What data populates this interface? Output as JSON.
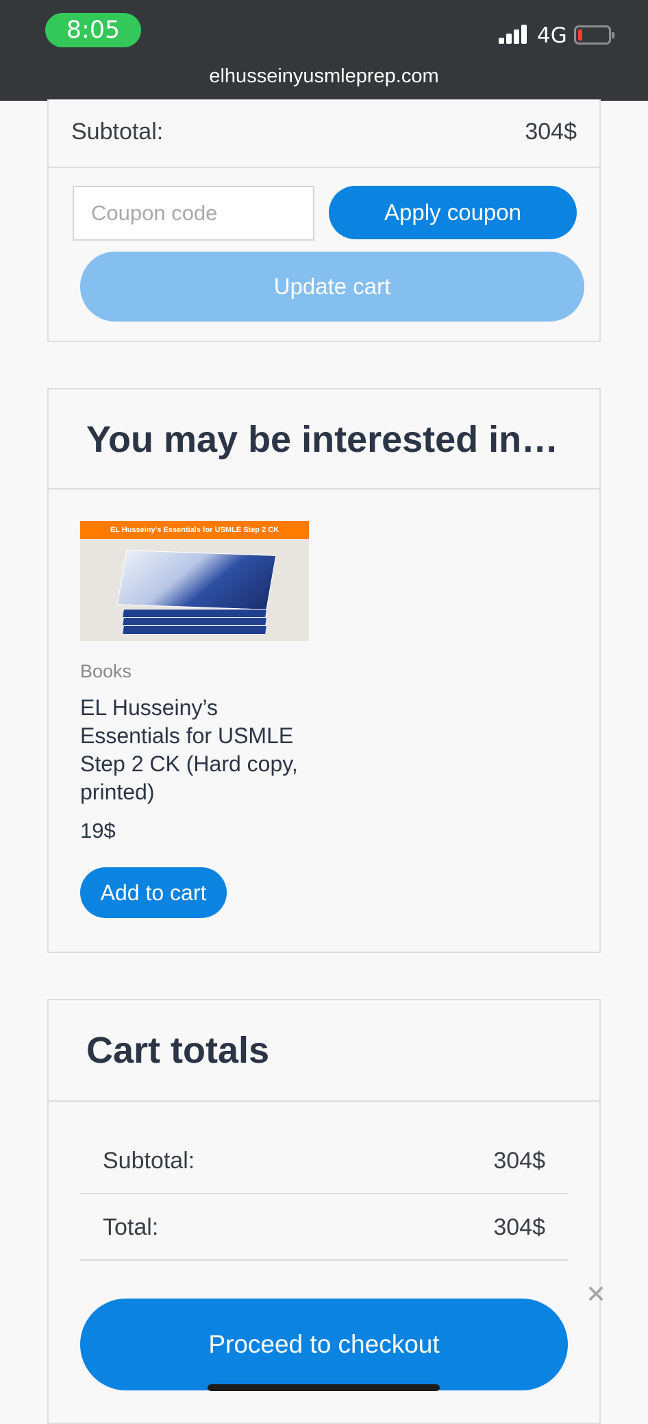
{
  "status_bar": {
    "time": "8:05",
    "network": "4G",
    "url": "elhusseinyusmleprep.com"
  },
  "cart_summary": {
    "subtotal_label": "Subtotal:",
    "subtotal_value": "304$",
    "coupon_placeholder": "Coupon code",
    "apply_coupon_label": "Apply coupon",
    "update_cart_label": "Update cart"
  },
  "cross_sells": {
    "title": "You may be interested in…",
    "product": {
      "image_banner": "EL Husseiny's Essentials for USMLE Step 2 CK",
      "category": "Books",
      "name": "EL Husseiny’s Essentials for USMLE Step 2 CK (Hard copy, printed)",
      "price": "19$",
      "add_to_cart_label": "Add to cart"
    }
  },
  "cart_totals": {
    "title": "Cart totals",
    "subtotal_label": "Subtotal:",
    "subtotal_value": "304$",
    "total_label": "Total:",
    "total_value": "304$",
    "checkout_label": "Proceed to checkout"
  },
  "colors": {
    "primary_button": "#0b83e0",
    "disabled_button": "#85bfef",
    "heading": "#2b3545",
    "time_pill": "#34c759"
  }
}
